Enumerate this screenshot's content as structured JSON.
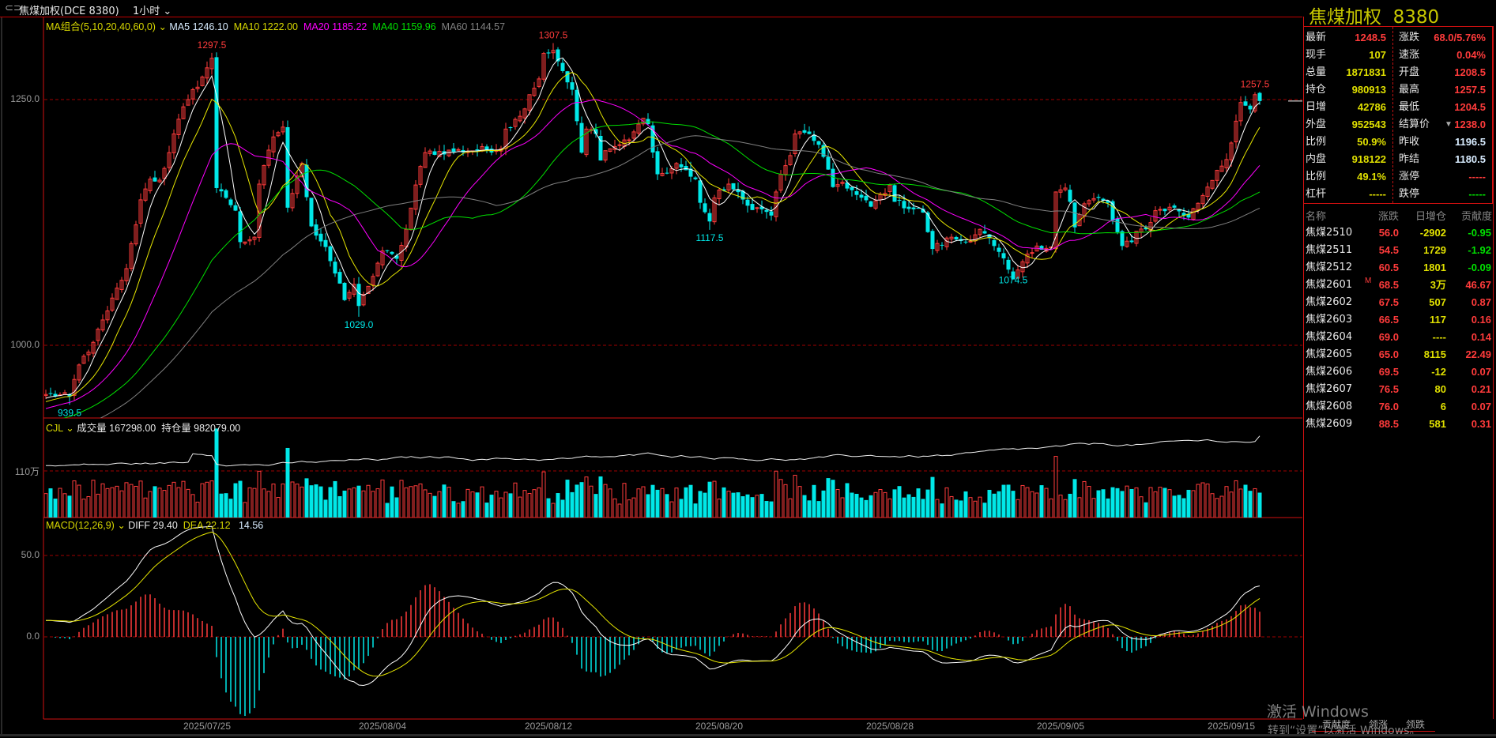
{
  "header": {
    "link_icon": "link-icon",
    "instrument": "焦煤加权(DCE 8380)",
    "period": "1小时",
    "period_icon": "chevron-down-icon"
  },
  "ma_legend": {
    "group": "MA组合(5,10,20,40,60,0)",
    "ma5": "MA5 1246.10",
    "ma10": "MA10 1222.00",
    "ma20": "MA20 1185.22",
    "ma40": "MA40 1159.96",
    "ma60": "MA60 1144.57"
  },
  "vol_legend": {
    "name": "CJL",
    "volume": "成交量 167298.00",
    "oi": "持仓量 982079.00"
  },
  "macd_legend": {
    "name": "MACD(12,26,9)",
    "diff": "DIFF 29.40",
    "dea": "DEA 22.12",
    "macd": "14.56"
  },
  "colors": {
    "up": "#ff3b3b",
    "down": "#00e8e8",
    "ma5": "#ffffff",
    "ma10": "#e6e600",
    "ma20": "#ff00ff",
    "ma40": "#00e000",
    "ma60": "#808080",
    "grid": "#a00000"
  },
  "chart_data": {
    "type": "candlestick",
    "title": "焦煤加权 8380 1小时",
    "price_ticks": [
      {
        "value": 1250,
        "label": "1250.0"
      },
      {
        "value": 1000,
        "label": "1000.0"
      }
    ],
    "volume_ticks": [
      {
        "value": 1100000,
        "label": "110万"
      }
    ],
    "macd_ticks": [
      {
        "value": 50,
        "label": "50.0"
      },
      {
        "value": 0,
        "label": "0.0"
      }
    ],
    "x_ticks": [
      {
        "index": 34,
        "label": "2025/07/25"
      },
      {
        "index": 71,
        "label": "2025/08/04"
      },
      {
        "index": 106,
        "label": "2025/08/12"
      },
      {
        "index": 142,
        "label": "2025/08/20"
      },
      {
        "index": 178,
        "label": "2025/08/28"
      },
      {
        "index": 214,
        "label": "2025/09/05"
      },
      {
        "index": 250,
        "label": "2025/09/15"
      }
    ],
    "bar_count": 257,
    "warmup_from": 860,
    "close_anchors": [
      [
        0,
        950
      ],
      [
        5,
        948
      ],
      [
        7,
        980
      ],
      [
        10,
        1003
      ],
      [
        13,
        1035
      ],
      [
        17,
        1078
      ],
      [
        20,
        1148
      ],
      [
        22,
        1169
      ],
      [
        24,
        1168
      ],
      [
        26,
        1196
      ],
      [
        28,
        1230
      ],
      [
        30,
        1250
      ],
      [
        33,
        1273
      ],
      [
        35,
        1292
      ],
      [
        36,
        1160
      ],
      [
        38,
        1150
      ],
      [
        40,
        1137
      ],
      [
        41,
        1105
      ],
      [
        44,
        1110
      ],
      [
        45,
        1164
      ],
      [
        48,
        1212
      ],
      [
        50,
        1222
      ],
      [
        51,
        1140
      ],
      [
        54,
        1185
      ],
      [
        56,
        1121
      ],
      [
        59,
        1100
      ],
      [
        63,
        1046
      ],
      [
        65,
        1062
      ],
      [
        66,
        1040
      ],
      [
        68,
        1060
      ],
      [
        71,
        1096
      ],
      [
        74,
        1088
      ],
      [
        76,
        1118
      ],
      [
        79,
        1182
      ],
      [
        80,
        1196
      ],
      [
        96,
        1200
      ],
      [
        97,
        1220
      ],
      [
        100,
        1233
      ],
      [
        102,
        1255
      ],
      [
        104,
        1271
      ],
      [
        105,
        1297
      ],
      [
        107,
        1300
      ],
      [
        109,
        1279
      ],
      [
        111,
        1260
      ],
      [
        112,
        1228
      ],
      [
        113,
        1196
      ],
      [
        114,
        1220
      ],
      [
        116,
        1215
      ],
      [
        117,
        1188
      ],
      [
        118,
        1198
      ],
      [
        121,
        1204
      ],
      [
        123,
        1209
      ],
      [
        126,
        1231
      ],
      [
        127,
        1225
      ],
      [
        129,
        1174
      ],
      [
        131,
        1175
      ],
      [
        133,
        1185
      ],
      [
        137,
        1169
      ],
      [
        138,
        1145
      ],
      [
        140,
        1126
      ],
      [
        141,
        1150
      ],
      [
        144,
        1164
      ],
      [
        148,
        1142
      ],
      [
        150,
        1140
      ],
      [
        153,
        1132
      ],
      [
        154,
        1156
      ],
      [
        155,
        1174
      ],
      [
        157,
        1193
      ],
      [
        158,
        1215
      ],
      [
        161,
        1215
      ],
      [
        163,
        1204
      ],
      [
        166,
        1161
      ],
      [
        168,
        1166
      ],
      [
        171,
        1153
      ],
      [
        174,
        1141
      ],
      [
        178,
        1163
      ],
      [
        179,
        1146
      ],
      [
        185,
        1135
      ],
      [
        187,
        1098
      ],
      [
        191,
        1110
      ],
      [
        194,
        1105
      ],
      [
        197,
        1118
      ],
      [
        200,
        1101
      ],
      [
        203,
        1077
      ],
      [
        204,
        1067
      ],
      [
        206,
        1085
      ],
      [
        209,
        1101
      ],
      [
        212,
        1100
      ],
      [
        213,
        1156
      ],
      [
        215,
        1160
      ],
      [
        216,
        1146
      ],
      [
        217,
        1120
      ],
      [
        219,
        1144
      ],
      [
        222,
        1150
      ],
      [
        224,
        1145
      ],
      [
        225,
        1127
      ],
      [
        227,
        1101
      ],
      [
        229,
        1105
      ],
      [
        230,
        1116
      ],
      [
        232,
        1118
      ],
      [
        234,
        1137
      ],
      [
        238,
        1140
      ],
      [
        241,
        1130
      ],
      [
        245,
        1161
      ],
      [
        247,
        1178
      ],
      [
        249,
        1189
      ],
      [
        251,
        1228
      ],
      [
        252,
        1247
      ],
      [
        254,
        1240
      ],
      [
        255,
        1255
      ],
      [
        256,
        1248.5
      ]
    ],
    "markers": [
      {
        "index": 35,
        "type": "high",
        "value": 1297.5,
        "label": "1297.5"
      },
      {
        "index": 107,
        "type": "high",
        "value": 1307.5,
        "label": "1307.5"
      },
      {
        "index": 255,
        "type": "high",
        "value": 1257.5,
        "label": "1257.5"
      },
      {
        "index": 5,
        "type": "low",
        "value": 939.5,
        "label": "939.5"
      },
      {
        "index": 66,
        "type": "low",
        "value": 1029.0,
        "label": "1029.0"
      },
      {
        "index": 140,
        "type": "low",
        "value": 1117.5,
        "label": "1117.5"
      },
      {
        "index": 204,
        "type": "low",
        "value": 1074.5,
        "label": "1074.5"
      }
    ],
    "last_price": 1248.5,
    "last_open_interest": 982079
  },
  "quote": {
    "name": "焦煤加权",
    "code": "8380",
    "left": [
      {
        "label": "最新",
        "value": "1248.5",
        "color": "red"
      },
      {
        "label": "现手",
        "value": "107",
        "color": "yel"
      },
      {
        "label": "总量",
        "value": "1871831",
        "color": "yel"
      },
      {
        "label": "持仓",
        "value": "980913",
        "color": "yel"
      },
      {
        "label": "日增",
        "value": "42786",
        "color": "yel"
      },
      {
        "label": "外盘",
        "value": "952543",
        "color": "yel"
      },
      {
        "label": "比例",
        "value": "50.9%",
        "color": "yel"
      },
      {
        "label": "内盘",
        "value": "918122",
        "color": "yel"
      },
      {
        "label": "比例",
        "value": "49.1%",
        "color": "yel"
      },
      {
        "label": "杠杆",
        "value": "-----",
        "color": "yel"
      }
    ],
    "right": [
      {
        "label": "涨跌",
        "value": "68.0/5.76%",
        "color": "red"
      },
      {
        "label": "速涨",
        "value": "0.04%",
        "color": "red"
      },
      {
        "label": "开盘",
        "value": "1208.5",
        "color": "red"
      },
      {
        "label": "最高",
        "value": "1257.5",
        "color": "red"
      },
      {
        "label": "最低",
        "value": "1204.5",
        "color": "red"
      },
      {
        "label": "结算价",
        "value": "1238.0",
        "color": "red"
      },
      {
        "label": "昨收",
        "value": "1196.5",
        "color": "blu"
      },
      {
        "label": "昨结",
        "value": "1180.5",
        "color": "blu"
      },
      {
        "label": "涨停",
        "value": "-----",
        "color": "red"
      },
      {
        "label": "跌停",
        "value": "-----",
        "color": "grn"
      }
    ]
  },
  "contracts": {
    "headers": [
      "名称",
      "涨跌",
      "日增仓",
      "贡献度"
    ],
    "rows": [
      {
        "name": "焦煤2510",
        "flag": "",
        "change": "56.0",
        "oi_change": "-2902",
        "contrib": "-0.95",
        "contrib_color": "grn"
      },
      {
        "name": "焦煤2511",
        "flag": "",
        "change": "54.5",
        "oi_change": "1729",
        "contrib": "-1.92",
        "contrib_color": "grn"
      },
      {
        "name": "焦煤2512",
        "flag": "",
        "change": "60.5",
        "oi_change": "1801",
        "contrib": "-0.09",
        "contrib_color": "grn"
      },
      {
        "name": "焦煤2601",
        "flag": "M",
        "change": "68.5",
        "oi_change": "3万",
        "contrib": "46.67",
        "contrib_color": "red"
      },
      {
        "name": "焦煤2602",
        "flag": "",
        "change": "67.5",
        "oi_change": "507",
        "contrib": "0.87",
        "contrib_color": "red"
      },
      {
        "name": "焦煤2603",
        "flag": "",
        "change": "66.5",
        "oi_change": "117",
        "contrib": "0.16",
        "contrib_color": "red"
      },
      {
        "name": "焦煤2604",
        "flag": "",
        "change": "69.0",
        "oi_change": "----",
        "contrib": "0.14",
        "contrib_color": "red"
      },
      {
        "name": "焦煤2605",
        "flag": "",
        "change": "65.0",
        "oi_change": "8115",
        "contrib": "22.49",
        "contrib_color": "red"
      },
      {
        "name": "焦煤2606",
        "flag": "",
        "change": "69.5",
        "oi_change": "-12",
        "contrib": "0.07",
        "contrib_color": "red"
      },
      {
        "name": "焦煤2607",
        "flag": "",
        "change": "76.5",
        "oi_change": "80",
        "contrib": "0.21",
        "contrib_color": "red"
      },
      {
        "name": "焦煤2608",
        "flag": "",
        "change": "76.0",
        "oi_change": "6",
        "contrib": "0.07",
        "contrib_color": "red"
      },
      {
        "name": "焦煤2609",
        "flag": "",
        "change": "88.5",
        "oi_change": "581",
        "contrib": "0.31",
        "contrib_color": "red"
      }
    ]
  },
  "bottom_tabs": [
    "贡献度",
    "领涨",
    "领跌"
  ],
  "watermark": {
    "line1": "激活 Windows",
    "line2": "转到“设置”以激活 Windows。"
  }
}
